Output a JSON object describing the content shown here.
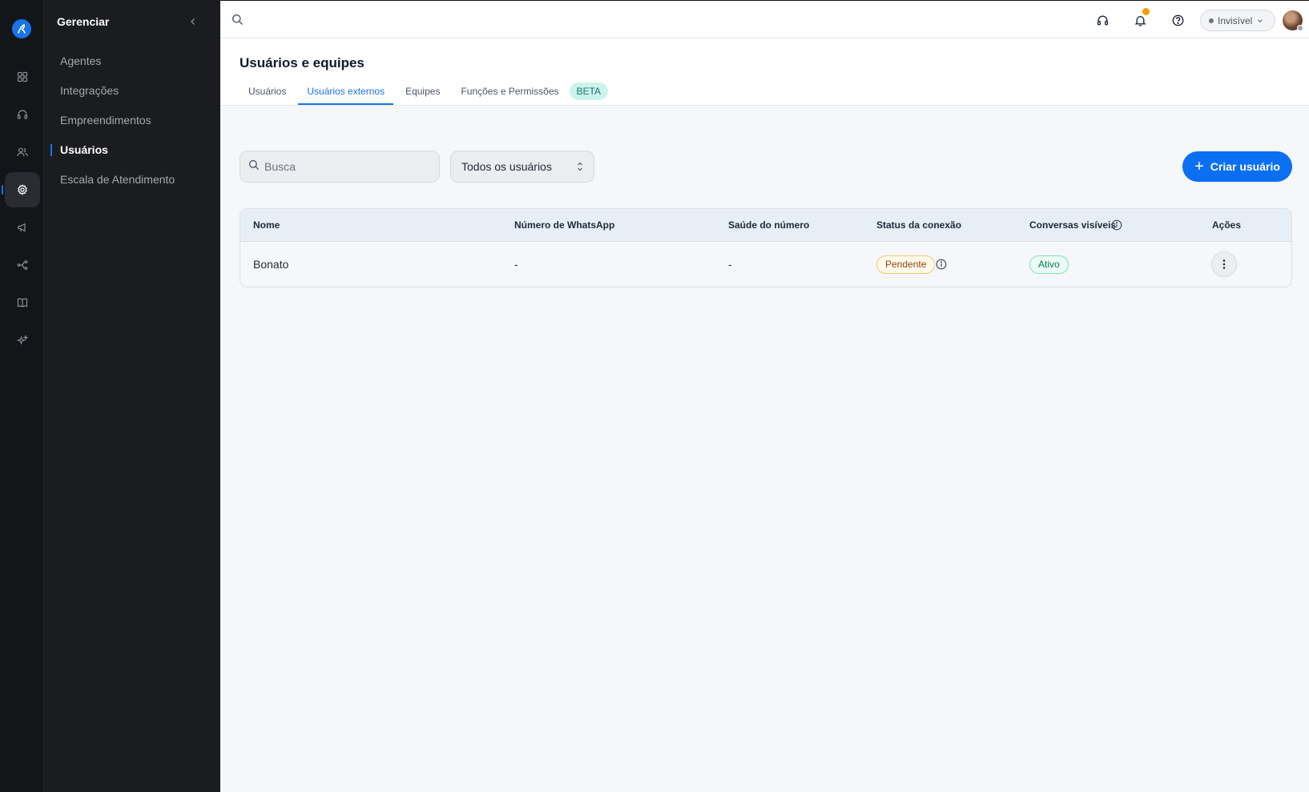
{
  "sidebar": {
    "title": "Gerenciar",
    "items": [
      {
        "label": "Agentes"
      },
      {
        "label": "Integrações"
      },
      {
        "label": "Empreendimentos"
      },
      {
        "label": "Usuários",
        "active": true
      },
      {
        "label": "Escala de Atendimento"
      }
    ]
  },
  "rail": {
    "icons": [
      "logo-icon",
      "dashboard-icon",
      "headset-icon",
      "users-icon",
      "settings-icon",
      "megaphone-icon",
      "flow-icon",
      "book-icon",
      "sparkles-icon"
    ],
    "active": "settings-icon"
  },
  "topbar": {
    "status_label": "Invisível",
    "icons": [
      "search-icon",
      "headset-icon",
      "bell-icon",
      "help-icon"
    ]
  },
  "page": {
    "title": "Usuários e equipes",
    "tabs": [
      {
        "label": "Usuários"
      },
      {
        "label": "Usuários externos",
        "active": true
      },
      {
        "label": "Equipes"
      },
      {
        "label": "Funções e Permissões"
      }
    ],
    "beta_label": "BETA"
  },
  "filters": {
    "search_placeholder": "Busca",
    "select_value": "Todos os usuários",
    "create_label": "Criar usuário"
  },
  "table": {
    "columns": [
      "Nome",
      "Número de WhatsApp",
      "Saúde do número",
      "Status da conexão",
      "Conversas visíveis",
      "Ações"
    ],
    "rows": [
      {
        "name": "Bonato",
        "whatsapp": "-",
        "health": "-",
        "connection_status": "Pendente",
        "visible_conversations": "Ativo"
      }
    ]
  },
  "colors": {
    "accent": "#0b6ff2",
    "sidebar_bg": "#1b1c20",
    "rail_bg": "#141519",
    "pending": "#f6c46a",
    "active": "#86e0b2",
    "beta_bg": "#ccf3ec"
  }
}
